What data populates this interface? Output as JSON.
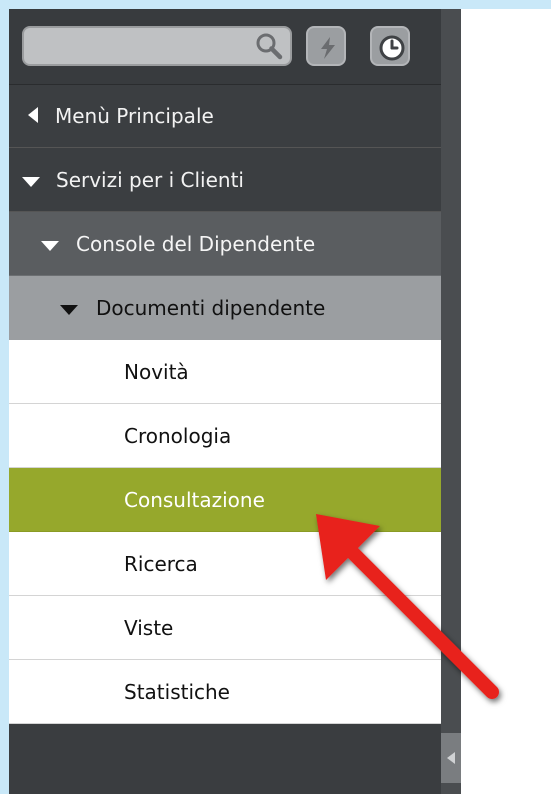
{
  "search": {
    "value": "",
    "placeholder": ""
  },
  "toolbar": {
    "search_icon": "magnifier",
    "flash_icon": "lightning-bolt",
    "history_icon": "clock"
  },
  "menu": {
    "main": {
      "label": "Menù Principale",
      "icon": "triangle-left"
    },
    "section": {
      "label": "Servizi per i Clienti",
      "icon": "triangle-down"
    },
    "subsection": {
      "label": "Console del Dipendente",
      "icon": "triangle-down"
    },
    "group": {
      "label": "Documenti dipendente",
      "icon": "triangle-down"
    },
    "items": [
      {
        "label": "Novità",
        "active": false
      },
      {
        "label": "Cronologia",
        "active": false
      },
      {
        "label": "Consultazione",
        "active": true
      },
      {
        "label": "Ricerca",
        "active": false
      },
      {
        "label": "Viste",
        "active": false
      },
      {
        "label": "Statistiche",
        "active": false
      }
    ]
  },
  "colors": {
    "page_background": "#c9e8f8",
    "sidebar": "#3a3d40",
    "active_item": "#96a82c",
    "annotation_arrow": "#e8201f"
  }
}
